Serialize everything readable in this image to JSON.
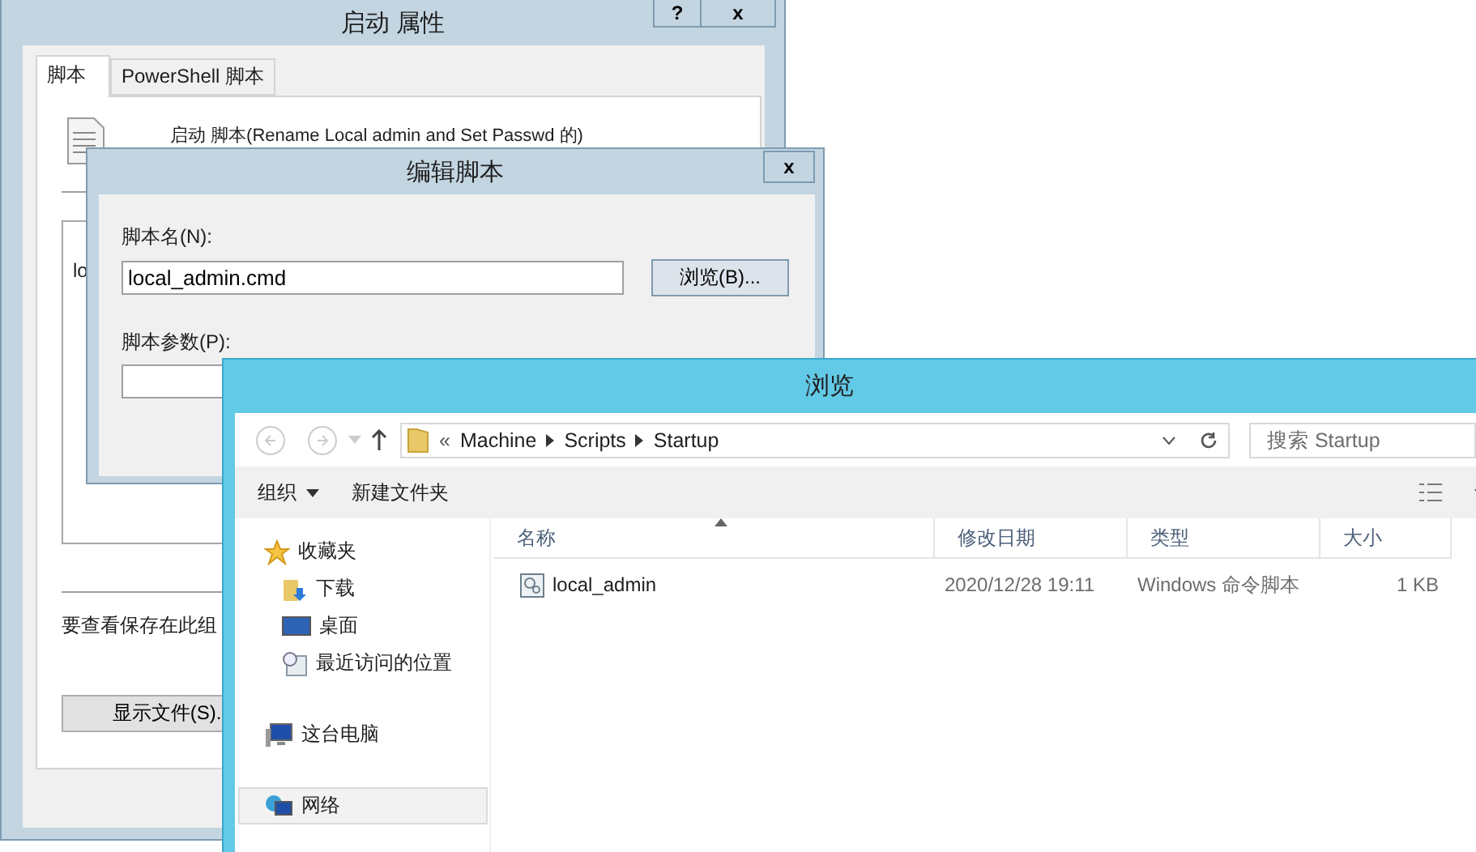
{
  "properties_window": {
    "title": "启动 属性",
    "help_button": "?",
    "close_button": "x",
    "tabs": [
      {
        "label": "脚本",
        "selected": true
      },
      {
        "label": "PowerShell 脚本",
        "selected": false
      }
    ],
    "heading": "启动 脚本(Rename Local admin and Set Passwd 的)",
    "list_row": "lo",
    "note": "要查看保存在此组",
    "show_files_button": "显示文件(S)."
  },
  "edit_dialog": {
    "title": "编辑脚本",
    "close_button": "x",
    "name_label": "脚本名(N):",
    "name_value": "local_admin.cmd",
    "browse_button": "浏览(B)...",
    "params_label": "脚本参数(P):"
  },
  "browse_window": {
    "title": "浏览",
    "overflow_mark": "«",
    "breadcrumb": [
      "Machine",
      "Scripts",
      "Startup"
    ],
    "search": {
      "placeholder": "搜索 Startup"
    },
    "toolbar": [
      {
        "label": "组织",
        "dropdown": true
      },
      {
        "label": "新建文件夹",
        "dropdown": false
      }
    ],
    "nav": [
      {
        "label": "收藏夹",
        "kind": "star",
        "selected": false,
        "children": [
          {
            "label": "下载",
            "kind": "download",
            "selected": false
          },
          {
            "label": "桌面",
            "kind": "desktop",
            "selected": false
          },
          {
            "label": "最近访问的位置",
            "kind": "recent",
            "selected": false
          }
        ]
      },
      {
        "label": "这台电脑",
        "kind": "computer",
        "selected": false
      },
      {
        "label": "网络",
        "kind": "network",
        "selected": true
      }
    ],
    "columns": [
      {
        "label": "名称",
        "sorted": true
      },
      {
        "label": "修改日期",
        "sorted": false
      },
      {
        "label": "类型",
        "sorted": false
      },
      {
        "label": "大小",
        "sorted": false
      }
    ],
    "rows": [
      {
        "name": "local_admin",
        "modified": "2020/12/28 19:11",
        "type": "Windows 命令脚本",
        "size": "1 KB"
      }
    ]
  }
}
